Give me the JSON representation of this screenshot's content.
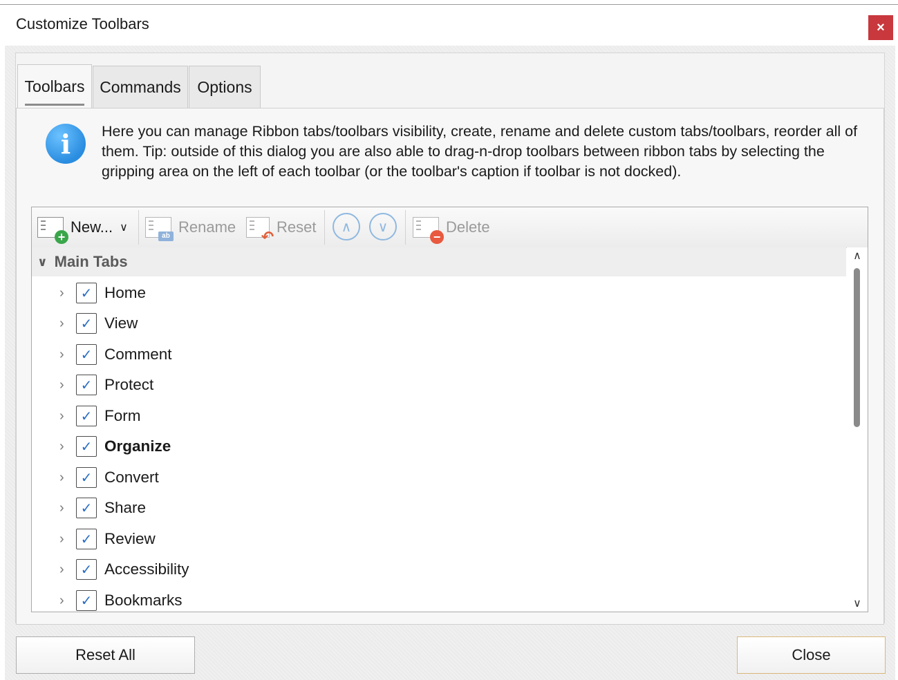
{
  "window": {
    "title": "Customize Toolbars",
    "close_glyph": "×"
  },
  "tabs": [
    {
      "label": "Toolbars",
      "active": true
    },
    {
      "label": "Commands",
      "active": false
    },
    {
      "label": "Options",
      "active": false
    }
  ],
  "info": {
    "icon": "info-icon",
    "text": "Here you can manage Ribbon tabs/toolbars visibility, create, rename and delete custom tabs/toolbars, reorder all of them. Tip: outside of this dialog you are also able to drag-n-drop toolbars between ribbon tabs by selecting the gripping area on the left of each toolbar (or the toolbar's caption if toolbar is not docked)."
  },
  "toolbar": {
    "new_label": "New...",
    "rename_label": "Rename",
    "reset_label": "Reset",
    "delete_label": "Delete"
  },
  "tree": {
    "group_label": "Main Tabs",
    "items": [
      {
        "label": "Home",
        "checked": true
      },
      {
        "label": "View",
        "checked": true
      },
      {
        "label": "Comment",
        "checked": true
      },
      {
        "label": "Protect",
        "checked": true
      },
      {
        "label": "Form",
        "checked": true
      },
      {
        "label": "Organize",
        "checked": true,
        "bold": true
      },
      {
        "label": "Convert",
        "checked": true
      },
      {
        "label": "Share",
        "checked": true
      },
      {
        "label": "Review",
        "checked": true
      },
      {
        "label": "Accessibility",
        "checked": true
      },
      {
        "label": "Bookmarks",
        "checked": true
      }
    ]
  },
  "buttons": {
    "reset_all": "Reset All",
    "close": "Close"
  },
  "colors": {
    "close_x_bg": "#c8383d",
    "info_blue": "#2a8de0",
    "check_blue": "#2a6ec4",
    "add_green": "#3aa64a",
    "delete_red": "#e8593f",
    "rename_blue": "#4a7fc1",
    "reset_orange": "#e0603a"
  }
}
